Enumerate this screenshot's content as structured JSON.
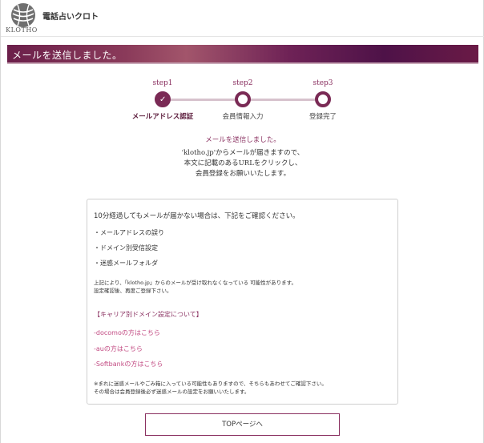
{
  "header": {
    "logo_text": "KLOTHO",
    "site_name": "電話占いクロト"
  },
  "banner": {
    "title": "メールを送信しました。"
  },
  "steps": [
    {
      "label": "step1",
      "name": "メールアドレス認証",
      "state": "done"
    },
    {
      "label": "step2",
      "name": "会員情報入力",
      "state": "pending"
    },
    {
      "label": "step3",
      "name": "登録完了",
      "state": "pending"
    }
  ],
  "message": {
    "title": "メールを送信しました。",
    "line1": "'klotho.jp'からメールが届きますので、",
    "line2": "本文に記載のあるURLをクリックし、",
    "line3": "会員登録をお願いいたします。"
  },
  "infobox": {
    "heading": "10分経過してもメールが届かない場合は、下記をご確認ください。",
    "reasons": [
      "・メールアドレスの誤り",
      "・ドメイン別受信設定",
      "・迷惑メールフォルダ"
    ],
    "note_line1": "上記により、「klotho.jp」からのメールが受け取れなくなっている 可能性があります。",
    "note_line2": "設定確認後、再度ご登録下さい。",
    "carrier_heading": "【キャリア別ドメイン設定について】",
    "links": [
      "-docomoの方はこちら",
      "-auの方はこちら",
      "-Softbankの方はこちら"
    ],
    "footer_line1": "※まれに迷惑メールやごみ箱に入っている可能性もありますので、そちらもあわせてご確認下さい。",
    "footer_line2": "その場合は会員登録後必ず迷惑メールの設定をお願いいたします。"
  },
  "top_button": {
    "label": "TOPページへ"
  },
  "colors": {
    "brand": "#7a2a55",
    "link": "#c24a82"
  }
}
